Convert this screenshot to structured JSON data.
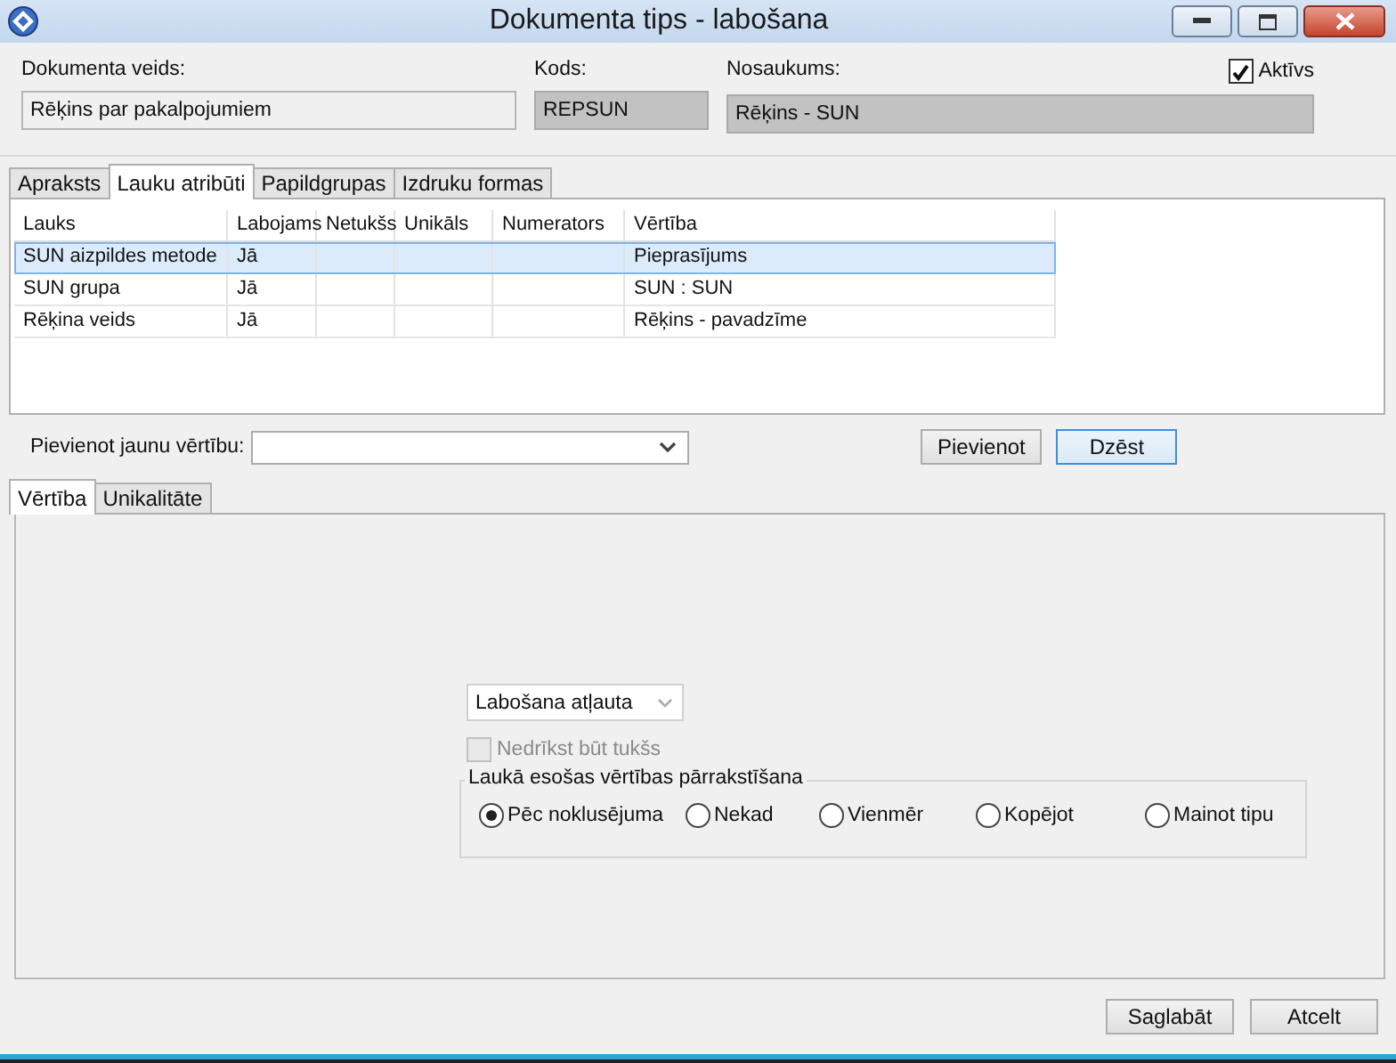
{
  "window": {
    "title": "Dokumenta tips - labošana"
  },
  "header": {
    "document_type": {
      "label": "Dokumenta veids:",
      "value": "Rēķins par pakalpojumiem"
    },
    "code": {
      "label": "Kods:",
      "value": "REPSUN"
    },
    "name": {
      "label": "Nosaukums:",
      "value": "Rēķins - SUN"
    },
    "active": {
      "label": "Aktīvs",
      "checked": true
    }
  },
  "tabs": [
    {
      "label": "Apraksts",
      "selected": false
    },
    {
      "label": "Lauku atribūti",
      "selected": true
    },
    {
      "label": "Papildgrupas",
      "selected": false
    },
    {
      "label": "Izdruku formas",
      "selected": false
    }
  ],
  "table": {
    "columns": [
      "Lauks",
      "Labojams",
      "Netukšs",
      "Unikāls",
      "Numerators",
      "Vērtība"
    ],
    "rows": [
      {
        "cells": [
          "SUN aizpildes metode",
          "Jā",
          "",
          "",
          "",
          "Pieprasījums"
        ],
        "selected": true
      },
      {
        "cells": [
          "SUN grupa",
          "Jā",
          "",
          "",
          "",
          "SUN : SUN"
        ],
        "selected": false
      },
      {
        "cells": [
          "Rēķina veids",
          "Jā",
          "",
          "",
          "",
          "Rēķins - pavadzīme"
        ],
        "selected": false
      }
    ]
  },
  "add_value": {
    "label": "Pievienot jaunu vērtību:",
    "buttons": [
      {
        "label": "Pievienot",
        "focused": false
      },
      {
        "label": "Dzēst",
        "focused": true
      }
    ]
  },
  "inner_tabs": [
    {
      "label": "Vērtība",
      "selected": true
    },
    {
      "label": "Unikalitāte",
      "selected": false
    }
  ],
  "edit_mode": {
    "value": "Labošana atļauta"
  },
  "not_empty": {
    "label": "Nedrīkst būt tukšs",
    "checked": false,
    "disabled": true
  },
  "overwrite": {
    "title": "Laukā esošas vērtības pārrakstīšana",
    "options": [
      {
        "label": "Pēc noklusējuma",
        "selected": true
      },
      {
        "label": "Nekad",
        "selected": false
      },
      {
        "label": "Vienmēr",
        "selected": false
      },
      {
        "label": "Kopējot",
        "selected": false
      },
      {
        "label": "Mainot tipu",
        "selected": false
      }
    ]
  },
  "buttons": [
    "Saglabāt",
    "Atcelt"
  ]
}
